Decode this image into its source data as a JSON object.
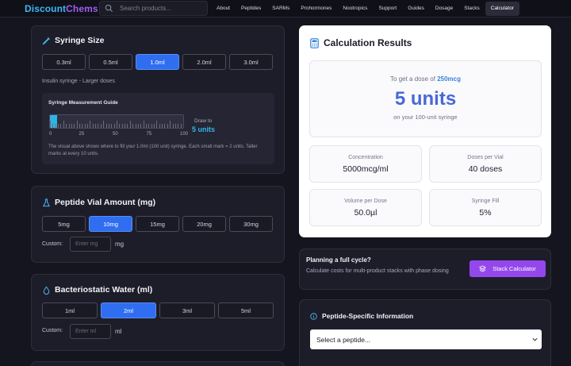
{
  "nav": {
    "logo_part1": "Discount",
    "logo_part2": "Chems",
    "search_placeholder": "Search products...",
    "links": [
      "About",
      "Peptides",
      "SARMs",
      "Prohormones",
      "Nootropics",
      "Support",
      "Guides",
      "Dosage",
      "Stacks",
      "Calculator"
    ],
    "active": "Calculator",
    "brand_blue": "#3db8f5",
    "brand_purple": "#9f5cf0"
  },
  "syringe": {
    "title": "Syringe Size",
    "icon": "syringe-icon",
    "options": [
      "0.3ml",
      "0.5ml",
      "1.0ml",
      "2.0ml",
      "3.0ml"
    ],
    "selected": "1.0ml",
    "description": "Insulin syringe - Larger doses",
    "guide": {
      "title": "Syringe Measurement Guide",
      "scale_labels": [
        "0",
        "25",
        "50",
        "75",
        "100"
      ],
      "fill_fraction": 0.05,
      "draw_to_label": "Draw to",
      "draw_to_value": "5 units",
      "note": "The visual above shows where to fill your 1.0ml (100 unit) syringe. Each small mark = 2 units. Taller marks at every 10 units."
    }
  },
  "vial": {
    "title": "Peptide Vial Amount (mg)",
    "icon": "flask-icon",
    "options": [
      "5mg",
      "10mg",
      "15mg",
      "20mg",
      "30mg"
    ],
    "selected": "10mg",
    "custom_label": "Custom:",
    "custom_placeholder": "Enter mg",
    "unit": "mg"
  },
  "water": {
    "title": "Bacteriostatic Water (ml)",
    "icon": "droplet-icon",
    "options": [
      "1ml",
      "2ml",
      "3ml",
      "5ml"
    ],
    "selected": "2ml",
    "custom_label": "Custom:",
    "custom_placeholder": "Enter ml",
    "unit": "ml"
  },
  "results": {
    "title": "Calculation Results",
    "icon": "calculator-icon",
    "dose_prefix": "To get a dose of",
    "dose_value": "250mcg",
    "units": "5 units",
    "syringe_note": "on your 100-unit syringe",
    "stats": [
      {
        "label": "Concentration",
        "value": "5000mcg/ml"
      },
      {
        "label": "Doses per Vial",
        "value": "40 doses"
      },
      {
        "label": "Volume per Dose",
        "value": "50.0µl"
      },
      {
        "label": "Syringe Fill",
        "value": "5%"
      }
    ]
  },
  "cycle": {
    "title": "Planning a full cycle?",
    "subtitle": "Calculate costs for multi-product stacks with phase dosing",
    "button": "Stack Calculator",
    "button_color": "#9448ec"
  },
  "info": {
    "title": "Peptide-Specific Information",
    "select_value": "Select a peptide..."
  }
}
